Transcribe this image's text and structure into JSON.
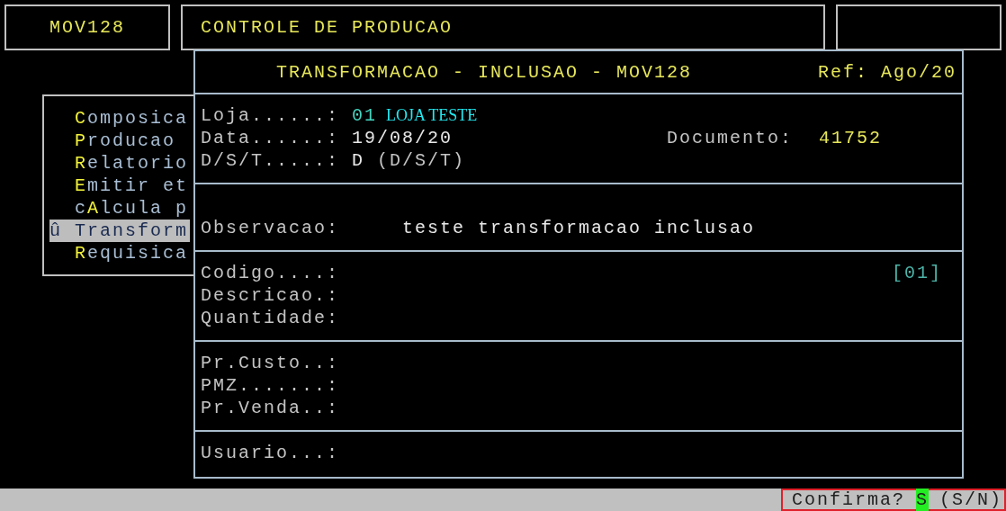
{
  "header": {
    "program": "MOV128",
    "title": "CONTROLE DE PRODUCAO"
  },
  "menu": [
    {
      "key": "C",
      "post": "omposica",
      "selected": false
    },
    {
      "key": "P",
      "post": "roducao",
      "selected": false
    },
    {
      "key": "R",
      "post": "elatorio",
      "selected": false
    },
    {
      "key": "E",
      "post": "mitir et",
      "selected": false
    },
    {
      "pre": "c",
      "key": "A",
      "post": "lcula p",
      "selected": false
    },
    {
      "pre": "û ",
      "post": "Transform",
      "selected": true
    },
    {
      "key": "R",
      "post": "equisica",
      "selected": false
    }
  ],
  "dialog": {
    "title": "TRANSFORMACAO - INCLUSAO - MOV128",
    "ref": "Ref: Ago/20",
    "loja": {
      "label": "Loja......:",
      "code": "01",
      "name": "LOJA TESTE"
    },
    "data": {
      "label": "Data......:",
      "value": "19/08/20"
    },
    "documento": {
      "label": "Documento:",
      "value": "41752"
    },
    "dst": {
      "label": "D/S/T.....:",
      "value": "D",
      "hint": "(D/S/T)"
    },
    "observacao": {
      "label": "Observacao:",
      "value": "teste transformacao inclusao"
    },
    "item_fields": [
      "Codigo....:",
      "Descricao.:",
      "Quantidade:"
    ],
    "item_index": "[01]",
    "price_fields": [
      "Pr.Custo..:",
      "PMZ.......:",
      "Pr.Venda..:"
    ],
    "user_fields": [
      "Usuario...:"
    ]
  },
  "status": {
    "prompt": "Confirma?",
    "answer": "S",
    "options": "(S/N)"
  }
}
